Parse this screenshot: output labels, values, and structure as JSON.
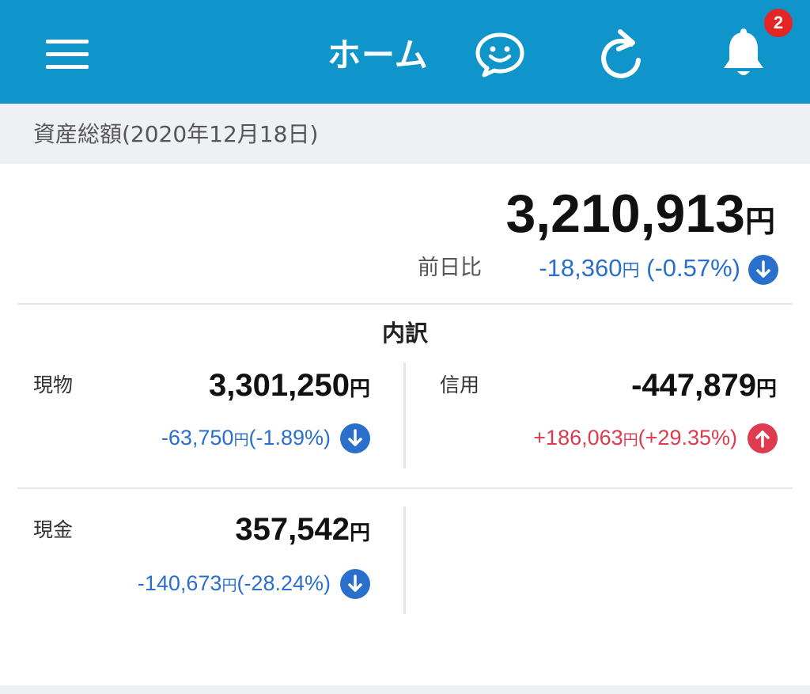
{
  "header": {
    "title": "ホーム",
    "notification_count": "2",
    "bg_color": "#0f95c9",
    "icons": [
      "menu-icon",
      "chat-smile-icon",
      "refresh-icon",
      "bell-icon"
    ]
  },
  "summary": {
    "date_label": "資産総額(2020年12月18日)",
    "total_value": "3,210,913",
    "yen": "円",
    "prev_day_label": "前日比",
    "prev_day_amount": "-18,360",
    "prev_day_pct": " (-0.57%)",
    "trend": "down"
  },
  "breakdown": {
    "title": "内訳",
    "items": [
      {
        "label": "現物",
        "value": "3,301,250",
        "yen": "円",
        "change_amount": "-63,750",
        "change_pct": "(-1.89%)",
        "trend": "down",
        "color": "#2a6fcc"
      },
      {
        "label": "信用",
        "value": "-447,879",
        "yen": "円",
        "change_amount": "+186,063",
        "change_pct": "(+29.35%)",
        "trend": "up",
        "color": "#de3b4e"
      },
      {
        "label": "現金",
        "value": "357,542",
        "yen": "円",
        "change_amount": "-140,673",
        "change_pct": "(-28.24%)",
        "trend": "down",
        "color": "#2a6fcc"
      }
    ]
  }
}
